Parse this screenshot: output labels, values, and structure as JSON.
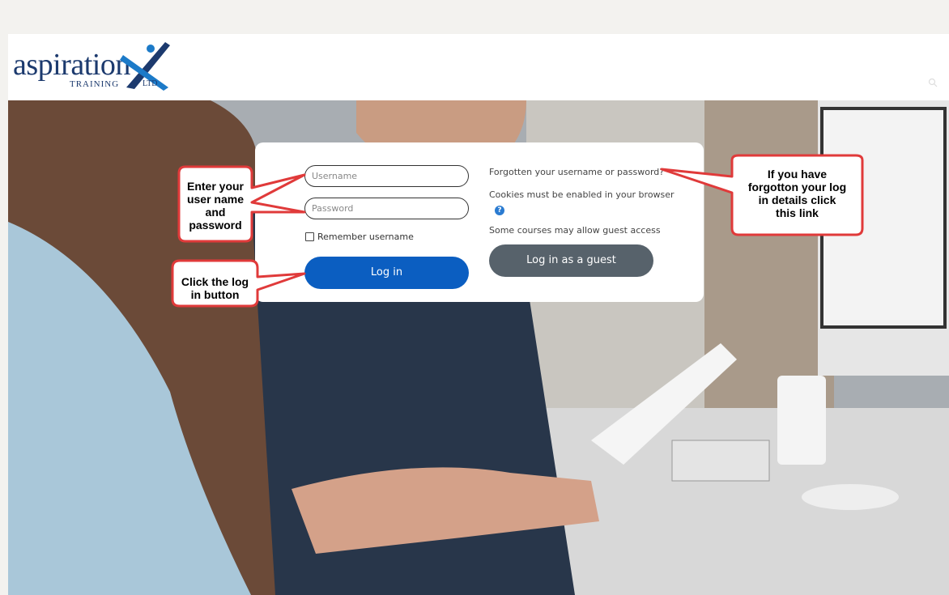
{
  "brand": {
    "name": "aspiration",
    "sub": "TRAINING",
    "suffix": "LTD"
  },
  "login": {
    "username_placeholder": "Username",
    "password_placeholder": "Password",
    "remember_label": "Remember username",
    "login_button": "Log in",
    "forgot_link": "Forgotten your username or password?",
    "cookies_text": "Cookies must be enabled in your browser",
    "guest_text": "Some courses may allow guest access",
    "guest_button": "Log in as a guest"
  },
  "callouts": {
    "enter_credentials": [
      "Enter your",
      "user name",
      "and",
      "password"
    ],
    "click_login": [
      "Click the log",
      "in button"
    ],
    "forgot": [
      "If you have",
      "forgotton your log",
      "in details click",
      "this link"
    ]
  },
  "colors": {
    "primary": "#0b5ec1",
    "guest": "#57626b",
    "callout_border": "#e03a3a",
    "brand": "#1c3a6e"
  },
  "icons": {
    "help": "question-circle-icon",
    "search": "search-icon"
  }
}
